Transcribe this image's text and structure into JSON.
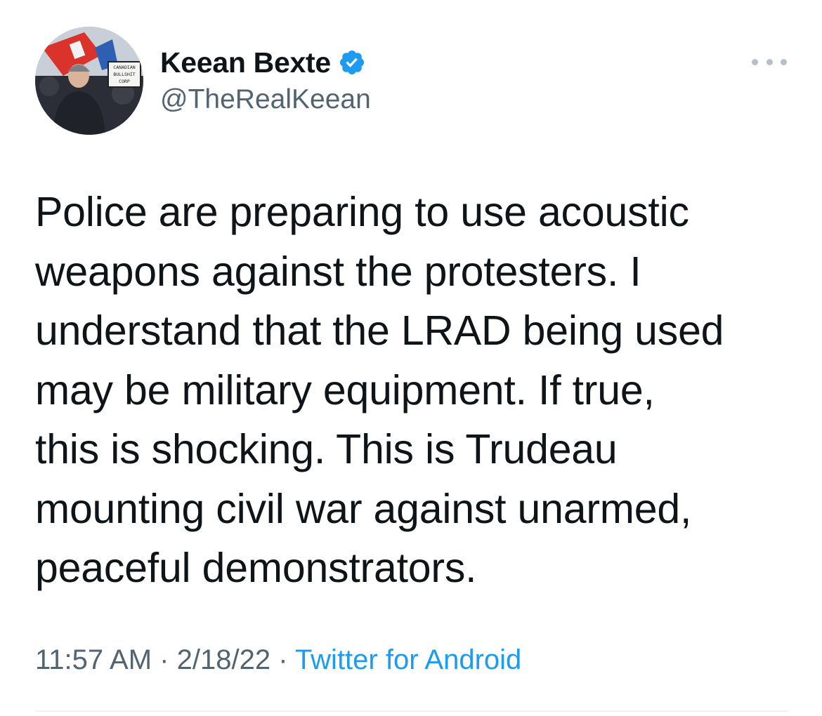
{
  "author": {
    "display_name": "Keean Bexte",
    "handle": "@TheRealKeean",
    "verified": true,
    "avatar_sign_text": [
      "CANADIAN",
      "BULLSHIT",
      "CORP"
    ]
  },
  "tweet": {
    "lines": [
      "Police are preparing to use acoustic",
      "weapons against the protesters. I",
      "understand that the LRAD being used",
      "may be military equipment. If true,",
      "this is shocking. This is Trudeau",
      "mounting civil war against unarmed,",
      "peaceful demonstrators."
    ]
  },
  "meta": {
    "time": "11:57 AM",
    "separator": "·",
    "date": "2/18/22",
    "source": "Twitter for Android"
  },
  "colors": {
    "accent": "#1d9bf0",
    "text": "#0f1419",
    "secondary": "#536471"
  },
  "icons": {
    "verified": "verified-badge-icon",
    "more": "more-options-icon"
  }
}
